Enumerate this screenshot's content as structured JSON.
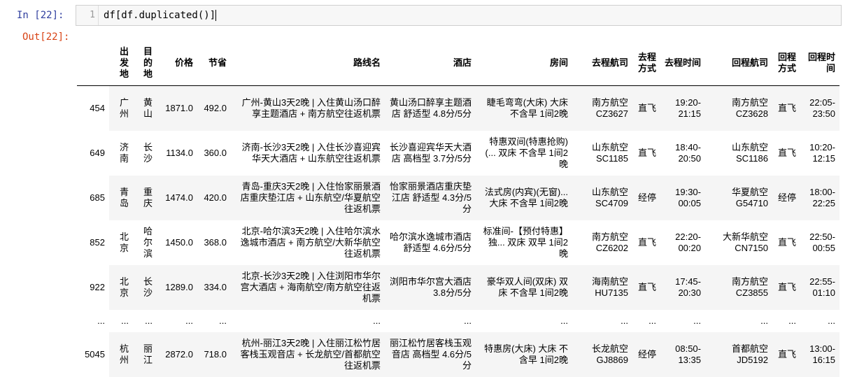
{
  "input_cell": {
    "prompt": "In  [22]:",
    "line_number": "1",
    "code": "df[df.duplicated()]"
  },
  "output_cell": {
    "prompt": "Out[22]:"
  },
  "table": {
    "columns": [
      "",
      "出发地",
      "目的地",
      "价格",
      "节省",
      "路线名",
      "酒店",
      "房间",
      "去程航司",
      "去程方式",
      "去程时间",
      "回程航司",
      "回程方式",
      "回程时间"
    ],
    "rows": [
      {
        "index": "454",
        "from": "广州",
        "to": "黄山",
        "price": "1871.0",
        "save": "492.0",
        "route": "广州-黄山3天2晚 | 入住黄山汤口醉享主题酒店 + 南方航空往返机票",
        "hotel": "黄山汤口醉享主题酒店 舒适型 4.8分/5分",
        "room": "睫毛弯弯(大床) 大床 不含早 1间2晚",
        "go_airline": "南方航空 CZ3627",
        "go_mode": "直飞",
        "go_time": "19:20-21:15",
        "back_airline": "南方航空 CZ3628",
        "back_mode": "直飞",
        "back_time": "22:05-23:50"
      },
      {
        "index": "649",
        "from": "济南",
        "to": "长沙",
        "price": "1134.0",
        "save": "360.0",
        "route": "济南-长沙3天2晚 | 入住长沙喜迎宾华天大酒店 + 山东航空往返机票",
        "hotel": "长沙喜迎宾华天大酒店 高档型 3.7分/5分",
        "room": "特惠双间(特惠抢购) (... 双床 不含早 1间2晚",
        "go_airline": "山东航空 SC1185",
        "go_mode": "直飞",
        "go_time": "18:40-20:50",
        "back_airline": "山东航空 SC1186",
        "back_mode": "直飞",
        "back_time": "10:20-12:15"
      },
      {
        "index": "685",
        "from": "青岛",
        "to": "重庆",
        "price": "1474.0",
        "save": "420.0",
        "route": "青岛-重庆3天2晚 | 入住怡家丽景酒店重庆垫江店 + 山东航空/华夏航空往返机票",
        "hotel": "怡家丽景酒店重庆垫江店 舒适型 4.3分/5分",
        "room": "法式房(内宾)(无窗)... 大床 不含早 1间2晚",
        "go_airline": "山东航空 SC4709",
        "go_mode": "经停",
        "go_time": "19:30-00:05",
        "back_airline": "华夏航空 G54710",
        "back_mode": "经停",
        "back_time": "18:00-22:25"
      },
      {
        "index": "852",
        "from": "北京",
        "to": "哈尔滨",
        "price": "1450.0",
        "save": "368.0",
        "route": "北京-哈尔滨3天2晚 | 入住哈尔滨水逸城市酒店 + 南方航空/大新华航空往返机票",
        "hotel": "哈尔滨水逸城市酒店 舒适型 4.6分/5分",
        "room": "标准间-【预付特惠】独... 双床 双早 1间2晚",
        "go_airline": "南方航空 CZ6202",
        "go_mode": "直飞",
        "go_time": "22:20-00:20",
        "back_airline": "大新华航空 CN7150",
        "back_mode": "直飞",
        "back_time": "22:50-00:55"
      },
      {
        "index": "922",
        "from": "北京",
        "to": "长沙",
        "price": "1289.0",
        "save": "334.0",
        "route": "北京-长沙3天2晚 | 入住浏阳市华尔宫大酒店 + 海南航空/南方航空往返机票",
        "hotel": "浏阳市华尔宫大酒店 3.8分/5分",
        "room": "豪华双人间(双床) 双床 不含早 1间2晚",
        "go_airline": "海南航空 HU7135",
        "go_mode": "直飞",
        "go_time": "17:45-20:30",
        "back_airline": "南方航空 CZ3855",
        "back_mode": "直飞",
        "back_time": "22:55-01:10"
      },
      {
        "index": "...",
        "from": "...",
        "to": "...",
        "price": "...",
        "save": "...",
        "route": "...",
        "hotel": "...",
        "room": "...",
        "go_airline": "...",
        "go_mode": "...",
        "go_time": "...",
        "back_airline": "...",
        "back_mode": "...",
        "back_time": "..."
      },
      {
        "index": "5045",
        "from": "杭州",
        "to": "丽江",
        "price": "2872.0",
        "save": "718.0",
        "route": "杭州-丽江3天2晚 | 入住丽江松竹居客栈玉观音店 + 长龙航空/首都航空往返机票",
        "hotel": "丽江松竹居客栈玉观音店 高档型 4.6分/5分",
        "room": "特惠房(大床) 大床 不含早 1间2晚",
        "go_airline": "长龙航空 GJ8869",
        "go_mode": "经停",
        "go_time": "08:50-13:35",
        "back_airline": "首都航空 JD5192",
        "back_mode": "直飞",
        "back_time": "13:00-16:15"
      }
    ]
  }
}
